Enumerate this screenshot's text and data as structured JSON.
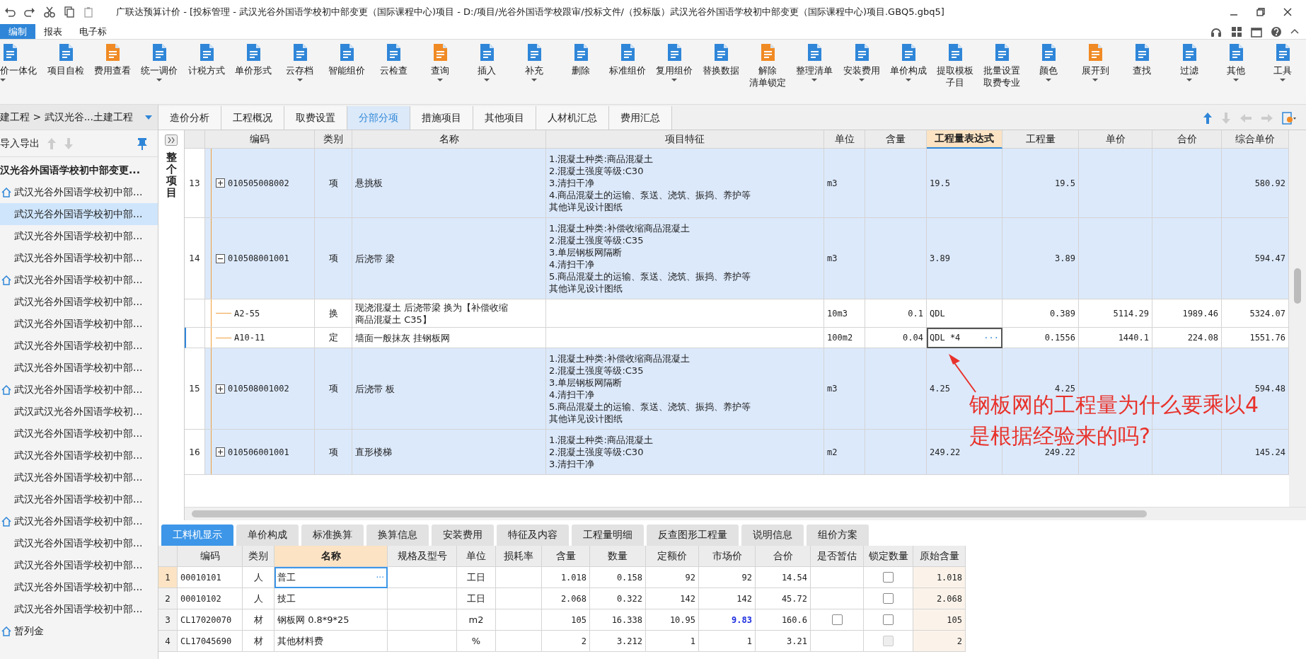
{
  "title_bar": {
    "title": "广联达预算计价 - [投标管理 - 武汉光谷外国语学校初中部变更（国际课程中心)项目 - D:/项目/光谷外国语学校跟审/投标文件/（投标版）武汉光谷外国语学校初中部变更（国际课程中心)项目.GBQ5.gbq5]"
  },
  "menu_tabs": [
    {
      "label": "编制",
      "selected": true
    },
    {
      "label": "报表",
      "selected": false
    },
    {
      "label": "电子标",
      "selected": false
    }
  ],
  "ribbon": [
    {
      "label": "价一体化",
      "dropdown": true
    },
    {
      "label": "项目自检",
      "dropdown": false
    },
    {
      "label": "费用查看",
      "dropdown": false
    },
    {
      "label": "统一调价",
      "dropdown": true
    },
    {
      "label": "计税方式",
      "dropdown": false
    },
    {
      "label": "单价形式",
      "dropdown": false
    },
    {
      "label": "云存档",
      "dropdown": true
    },
    {
      "label": "智能组价",
      "dropdown": false
    },
    {
      "label": "云检查",
      "dropdown": false
    },
    {
      "label": "查询",
      "dropdown": true
    },
    {
      "label": "插入",
      "dropdown": true
    },
    {
      "label": "补充",
      "dropdown": true
    },
    {
      "label": "删除",
      "dropdown": false
    },
    {
      "label": "标准组价",
      "dropdown": false
    },
    {
      "label": "复用组价",
      "dropdown": true
    },
    {
      "label": "替换数据",
      "dropdown": false
    },
    {
      "label": [
        "解除",
        "清单锁定"
      ],
      "dropdown": false
    },
    {
      "label": "整理清单",
      "dropdown": true
    },
    {
      "label": "安装费用",
      "dropdown": true
    },
    {
      "label": "单价构成",
      "dropdown": true
    },
    {
      "label": [
        "提取模板",
        "子目"
      ],
      "dropdown": false
    },
    {
      "label": [
        "批量设置",
        "取费专业"
      ],
      "dropdown": false
    },
    {
      "label": "颜色",
      "dropdown": true
    },
    {
      "label": "展开到",
      "dropdown": true
    },
    {
      "label": "查找",
      "dropdown": false
    },
    {
      "label": "过滤",
      "dropdown": true
    },
    {
      "label": "其他",
      "dropdown": true
    },
    {
      "label": "工具",
      "dropdown": true
    }
  ],
  "sidebar": {
    "breadcrumb": "建工程 > 武汉光谷...土建工程",
    "toolbar_label": "导入导出",
    "root": "汉光谷外国语学校初中部变更...",
    "items": [
      {
        "kind": "unit",
        "label": "武汉光谷外国语学校初中部...",
        "selected": false
      },
      {
        "kind": "part",
        "label": "武汉光谷外国语学校初中部...",
        "selected": true
      },
      {
        "kind": "part",
        "label": "武汉光谷外国语学校初中部...",
        "selected": false
      },
      {
        "kind": "part",
        "label": "武汉光谷外国语学校初中部...",
        "selected": false
      },
      {
        "kind": "unit",
        "label": "武汉光谷外国语学校初中部...",
        "selected": false
      },
      {
        "kind": "part",
        "label": "武汉光谷外国语学校初中部...",
        "selected": false
      },
      {
        "kind": "part",
        "label": "武汉光谷外国语学校初中部...",
        "selected": false
      },
      {
        "kind": "part",
        "label": "武汉光谷外国语学校初中部...",
        "selected": false
      },
      {
        "kind": "part",
        "label": "武汉光谷外国语学校初中部...",
        "selected": false
      },
      {
        "kind": "unit",
        "label": "武汉光谷外国语学校初中部...",
        "selected": false
      },
      {
        "kind": "part",
        "label": "武汉武汉光谷外国语学校初...",
        "selected": false
      },
      {
        "kind": "part",
        "label": "武汉光谷外国语学校初中部...",
        "selected": false
      },
      {
        "kind": "part",
        "label": "武汉光谷外国语学校初中部...",
        "selected": false
      },
      {
        "kind": "part",
        "label": "武汉光谷外国语学校初中部...",
        "selected": false
      },
      {
        "kind": "part",
        "label": "武汉光谷外国语学校初中部...",
        "selected": false
      },
      {
        "kind": "unit",
        "label": "武汉光谷外国语学校初中部...",
        "selected": false
      },
      {
        "kind": "part",
        "label": "武汉光谷外国语学校初中部...",
        "selected": false
      },
      {
        "kind": "part",
        "label": "武汉光谷外国语学校初中部...",
        "selected": false
      },
      {
        "kind": "part",
        "label": "武汉光谷外国语学校初中部...",
        "selected": false
      },
      {
        "kind": "part",
        "label": "武汉光谷外国语学校初中部...",
        "selected": false
      },
      {
        "kind": "unit",
        "label": "暂列金",
        "selected": false
      }
    ]
  },
  "scope_label": "整个项目",
  "main_tabs": [
    {
      "label": "造价分析",
      "selected": false
    },
    {
      "label": "工程概况",
      "selected": false
    },
    {
      "label": "取费设置",
      "selected": false
    },
    {
      "label": "分部分项",
      "selected": true
    },
    {
      "label": "措施项目",
      "selected": false
    },
    {
      "label": "其他项目",
      "selected": false
    },
    {
      "label": "人材机汇总",
      "selected": false
    },
    {
      "label": "费用汇总",
      "selected": false
    }
  ],
  "table": {
    "columns": [
      {
        "label": "编码",
        "highlighted": false
      },
      {
        "label": "类别",
        "highlighted": false
      },
      {
        "label": "名称",
        "highlighted": false
      },
      {
        "label": "项目特征",
        "highlighted": false
      },
      {
        "label": "单位",
        "highlighted": false
      },
      {
        "label": "含量",
        "highlighted": false
      },
      {
        "label": "工程量表达式",
        "highlighted": true
      },
      {
        "label": "工程量",
        "highlighted": false
      },
      {
        "label": "单价",
        "highlighted": false
      },
      {
        "label": "合价",
        "highlighted": false
      },
      {
        "label": "综合单价",
        "highlighted": false
      }
    ],
    "rows": [
      {
        "kind": "item",
        "no": "13",
        "expanded": false,
        "selected": false,
        "code": "010505008002",
        "type": "项",
        "name": "悬挑板",
        "features": [
          "1.混凝土种类:商品混凝土",
          "2.混凝土强度等级:C30",
          "3.清扫干净",
          "4.商品混凝土的运输、泵送、浇筑、振捣、养护等",
          "其他详见设计图纸"
        ],
        "unit": "m3",
        "expr": "19.5",
        "qty": "19.5",
        "unit_price": "580.92"
      },
      {
        "kind": "item",
        "no": "14",
        "expanded": true,
        "selected": false,
        "code": "010508001001",
        "type": "项",
        "name": "后浇带 梁",
        "features": [
          "1.混凝土种类:补偿收缩商品混凝土",
          "2.混凝土强度等级:C35",
          "3.单层钢板网隔断",
          "4.清扫干净",
          "5.商品混凝土的运输、泵送、浇筑、振捣、养护等",
          "其他详见设计图纸"
        ],
        "unit": "m3",
        "expr": "3.89",
        "qty": "3.89",
        "unit_price": "594.47"
      },
      {
        "kind": "sub",
        "selected": false,
        "code": "A2-55",
        "type": "换",
        "name": [
          "现浇混凝土 后浇带梁  换为【补偿收缩",
          "商品混凝土 C35】"
        ],
        "unit": "10m3",
        "content": "0.1",
        "expr": "QDL",
        "qty": "0.389",
        "price": "5114.29",
        "total": "1989.46",
        "unit_price": "5324.07"
      },
      {
        "kind": "sub",
        "selected": true,
        "cell_button": "···",
        "code": "A10-11",
        "type": "定",
        "name": "墙面一般抹灰 挂钢板网",
        "unit": "100m2",
        "content": "0.04",
        "expr": "QDL *4",
        "qty": "0.1556",
        "price": "1440.1",
        "total": "224.08",
        "unit_price": "1551.76"
      },
      {
        "kind": "item",
        "no": "15",
        "expanded": false,
        "selected": false,
        "code": "010508001002",
        "type": "项",
        "name": "后浇带 板",
        "features": [
          "1.混凝土种类:补偿收缩商品混凝土",
          "2.混凝土强度等级:C35",
          "3.单层钢板网隔断",
          "4.清扫干净",
          "5.商品混凝土的运输、泵送、浇筑、振捣、养护等",
          "其他详见设计图纸"
        ],
        "unit": "m3",
        "expr": "4.25",
        "qty": "4.25",
        "unit_price": "594.48"
      },
      {
        "kind": "item",
        "no": "16",
        "expanded": false,
        "selected": false,
        "code": "010506001001",
        "type": "项",
        "name": "直形楼梯",
        "features": [
          "1.混凝土种类:商品混凝土",
          "2.混凝土强度等级:C30",
          "3.清扫干净"
        ],
        "unit": "m2",
        "expr": "249.22",
        "qty": "249.22",
        "unit_price": "145.24"
      }
    ]
  },
  "annotation": {
    "lines": [
      "钢板网的工程量为什么要乘以4",
      "是根据经验来的吗?"
    ]
  },
  "bottom_tabs": [
    {
      "label": "工料机显示",
      "selected": true
    },
    {
      "label": "单价构成",
      "selected": false
    },
    {
      "label": "标准换算",
      "selected": false
    },
    {
      "label": "换算信息",
      "selected": false
    },
    {
      "label": "安装费用",
      "selected": false
    },
    {
      "label": "特征及内容",
      "selected": false
    },
    {
      "label": "工程量明细",
      "selected": false
    },
    {
      "label": "反查图形工程量",
      "selected": false
    },
    {
      "label": "说明信息",
      "selected": false
    },
    {
      "label": "组价方案",
      "selected": false
    }
  ],
  "resource_table": {
    "columns": [
      {
        "label": "编码",
        "highlighted": false
      },
      {
        "label": "类别",
        "highlighted": false
      },
      {
        "label": "名称",
        "highlighted": true
      },
      {
        "label": "规格及型号",
        "highlighted": false
      },
      {
        "label": "单位",
        "highlighted": false
      },
      {
        "label": "损耗率",
        "highlighted": false
      },
      {
        "label": "含量",
        "highlighted": false
      },
      {
        "label": "数量",
        "highlighted": false
      },
      {
        "label": "定额价",
        "highlighted": false
      },
      {
        "label": "市场价",
        "highlighted": false
      },
      {
        "label": "合价",
        "highlighted": false
      },
      {
        "label": "是否暂估",
        "highlighted": false
      },
      {
        "label": "锁定数量",
        "highlighted": false
      },
      {
        "label": "原始含量",
        "highlighted": false
      }
    ],
    "rows": [
      {
        "no": "1",
        "selected": true,
        "cell_button": "···",
        "code": "00010101",
        "type": "人",
        "name": "普工",
        "unit": "工日",
        "content": "1.018",
        "qty": "0.158",
        "quota_price": "92",
        "market_price": "92",
        "market_modified": false,
        "total": "14.54",
        "lock": {
          "checked": false,
          "disabled": false
        },
        "original": "1.018"
      },
      {
        "no": "2",
        "selected": false,
        "code": "00010102",
        "type": "人",
        "name": "技工",
        "unit": "工日",
        "content": "2.068",
        "qty": "0.322",
        "quota_price": "142",
        "market_price": "142",
        "market_modified": false,
        "total": "45.72",
        "lock": {
          "checked": false,
          "disabled": false
        },
        "original": "2.068"
      },
      {
        "no": "3",
        "selected": false,
        "code": "CL17020070",
        "type": "材",
        "name": "钢板网 0.8*9*25",
        "unit": "m2",
        "content": "105",
        "qty": "16.338",
        "quota_price": "10.95",
        "market_price": "9.83",
        "market_modified": true,
        "total": "160.6",
        "estimate": {
          "checked": false
        },
        "lock": {
          "checked": false,
          "disabled": false
        },
        "original": "105"
      },
      {
        "no": "4",
        "selected": false,
        "code": "CL17045690",
        "type": "材",
        "name": "其他材料费",
        "unit": "%",
        "content": "2",
        "qty": "3.212",
        "quota_price": "1",
        "market_price": "1",
        "market_modified": false,
        "total": "3.21",
        "lock": {
          "checked": false,
          "disabled": true
        },
        "original": "2"
      }
    ]
  }
}
